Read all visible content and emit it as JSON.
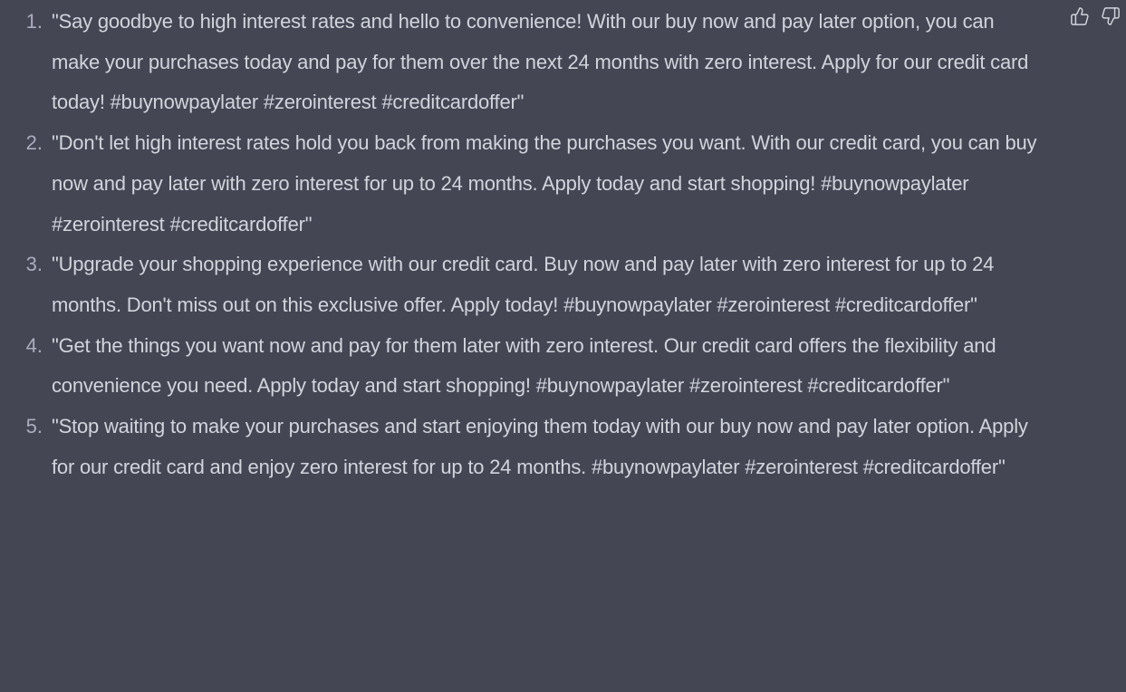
{
  "response": {
    "items": [
      {
        "number": "1.",
        "text": "\"Say goodbye to high interest rates and hello to convenience! With our buy now and pay later option, you can make your purchases today and pay for them over the next 24 months with zero interest. Apply for our credit card today! #buynowpaylater #zerointerest #creditcardoffer\""
      },
      {
        "number": "2.",
        "text": "\"Don't let high interest rates hold you back from making the purchases you want. With our credit card, you can buy now and pay later with zero interest for up to 24 months. Apply today and start shopping! #buynowpaylater #zerointerest #creditcardoffer\""
      },
      {
        "number": "3.",
        "text": "\"Upgrade your shopping experience with our credit card. Buy now and pay later with zero interest for up to 24 months. Don't miss out on this exclusive offer. Apply today! #buynowpaylater #zerointerest #creditcardoffer\""
      },
      {
        "number": "4.",
        "text": "\"Get the things you want now and pay for them later with zero interest. Our credit card offers the flexibility and convenience you need. Apply today and start shopping! #buynowpaylater #zerointerest #creditcardoffer\""
      },
      {
        "number": "5.",
        "text": "\"Stop waiting to make your purchases and start enjoying them today with our buy now and pay later option. Apply for our credit card and enjoy zero interest for up to 24 months. #buynowpaylater #zerointerest #creditcardoffer\""
      }
    ]
  },
  "feedback": {
    "thumbs_up_icon": "thumbs-up-icon",
    "thumbs_down_icon": "thumbs-down-icon"
  },
  "colors": {
    "background": "#444654",
    "text": "#d1d5db",
    "muted": "#acacbe"
  }
}
